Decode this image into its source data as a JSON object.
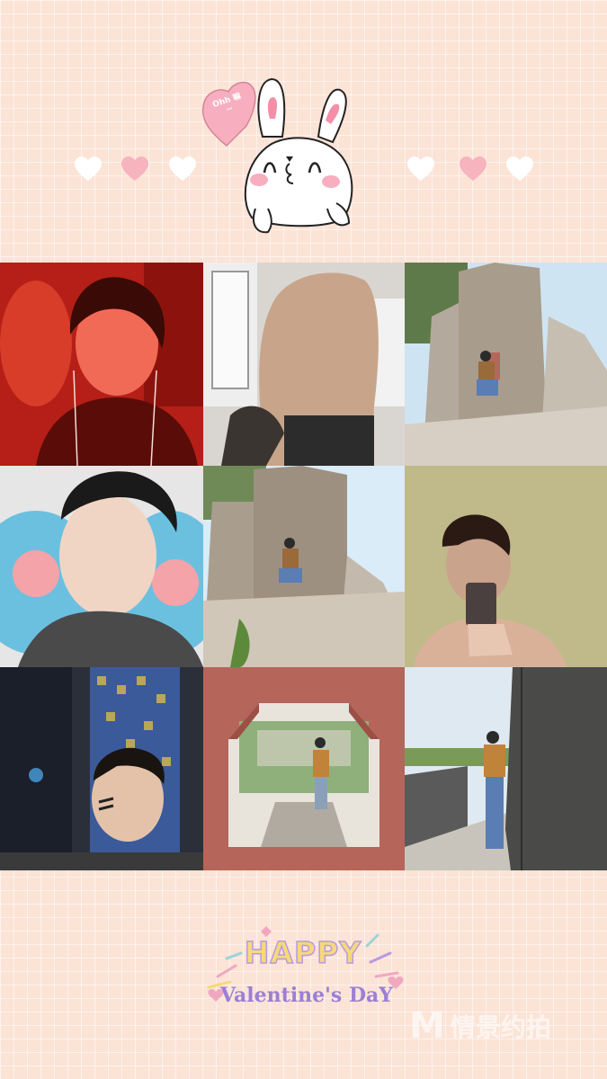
{
  "header": {
    "bubble_text": "Ohh 嘛~",
    "colors": {
      "heart_pink": "#f7b3be",
      "heart_white": "#ffffff",
      "bunny_ear": "#f48fa8"
    }
  },
  "gallery": {
    "photos": [
      {
        "subject": "red-lit selfie with earphones"
      },
      {
        "subject": "shirtless torso by window"
      },
      {
        "subject": "man sitting by carved rock"
      },
      {
        "subject": "selfie with blue pillow"
      },
      {
        "subject": "man sitting in front of carved stone monument"
      },
      {
        "subject": "mirror selfie with phone"
      },
      {
        "subject": "selfie in front of mosaic wall"
      },
      {
        "subject": "man standing in red octagonal gate"
      },
      {
        "subject": "man walking along stone wall"
      }
    ]
  },
  "footer": {
    "happy_text": "HAPPY",
    "valentine_text": "Valentine's DaY",
    "watermark_text": "情景约拍",
    "watermark_mark": "M"
  }
}
